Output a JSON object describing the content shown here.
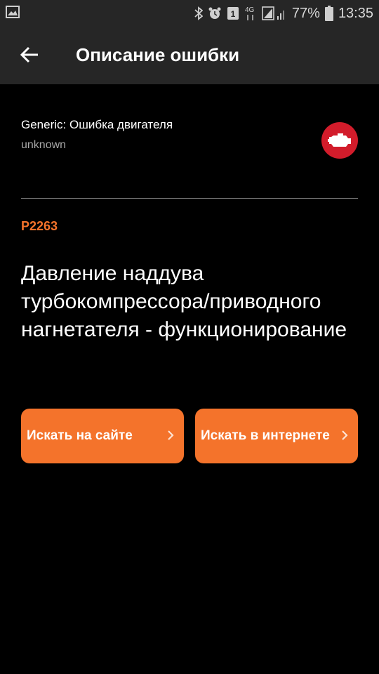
{
  "status_bar": {
    "battery_percent": "77%",
    "time": "13:35",
    "network": "4G",
    "sim_slot": "1",
    "icons": [
      "gallery-icon",
      "bluetooth-icon",
      "alarm-icon",
      "sim-icon",
      "network-4g-icon",
      "signal-icon",
      "battery-icon"
    ]
  },
  "app_bar": {
    "title": "Описание ошибки"
  },
  "vehicle": {
    "make": "Generic: Ошибка двигателя",
    "model": "unknown"
  },
  "error": {
    "code": "P2263",
    "description": "Давление наддува турбокомпрессора/приводного нагнетателя - функционирование"
  },
  "actions": {
    "search_site": "Искать на сайте",
    "search_web": "Искать в интернете"
  },
  "colors": {
    "accent": "#f4732b",
    "engine_icon_bg": "#d21c2b",
    "bar_bg": "#262626"
  }
}
